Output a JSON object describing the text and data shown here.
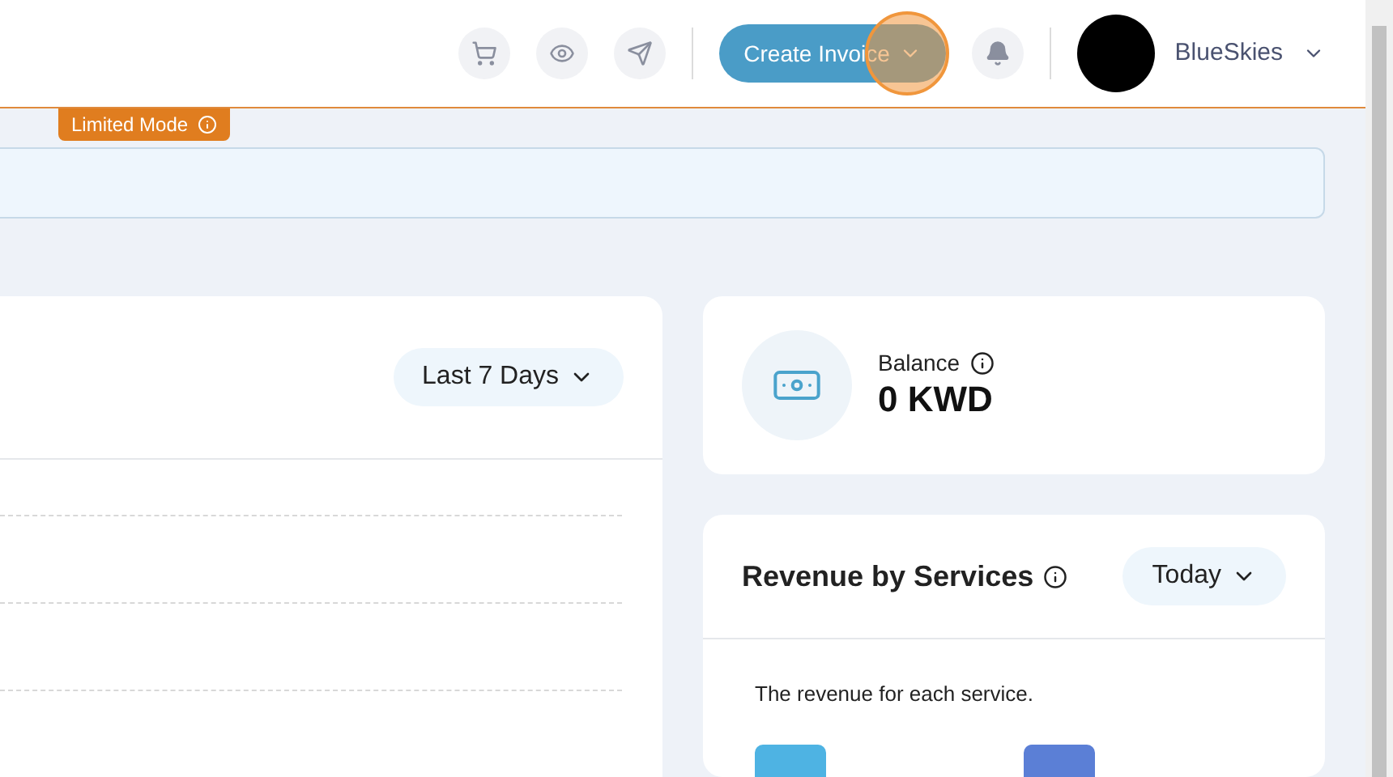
{
  "header": {
    "create_button": "Create Invoice",
    "account_name": "BlueSkies",
    "click_highlight": true
  },
  "limited_badge": {
    "label": "Limited Mode"
  },
  "sales_card": {
    "period": "Last 7 Days"
  },
  "balance_card": {
    "label": "Balance",
    "value": "0 KWD"
  },
  "revenue_card": {
    "title": "Revenue by Services",
    "period": "Today",
    "description": "The revenue for each service.",
    "legend": [
      {
        "color": "#4eb3e3"
      },
      {
        "color": "#5b7fd6"
      }
    ]
  }
}
